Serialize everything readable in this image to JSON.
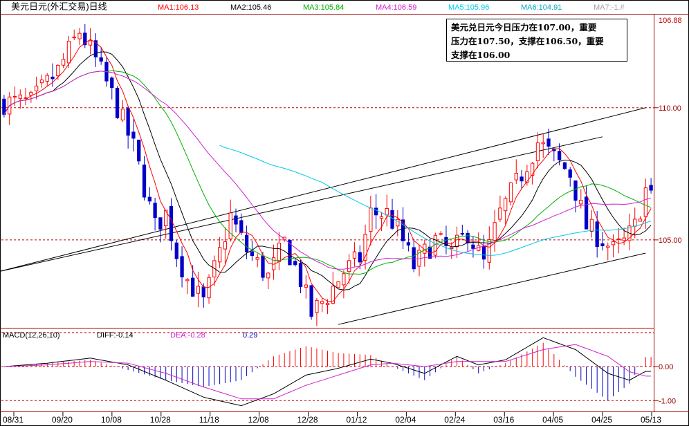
{
  "chart_data": {
    "type": "candlestick",
    "title": "美元日元(外汇交易)日线",
    "indicators": [
      {
        "label": "MA1:106.13",
        "color": "#ff0000"
      },
      {
        "label": "MA2:105.46",
        "color": "#000000"
      },
      {
        "label": "MA3:105.84",
        "color": "#00b000"
      },
      {
        "label": "MA4:106.59",
        "color": "#d020d0"
      },
      {
        "label": "MA5:105.96",
        "color": "#00c8e8"
      },
      {
        "label": "MA6:104.91",
        "color": "#00a8c0"
      },
      {
        "label": "MA7:-1.#",
        "color": "#a0a0a0"
      }
    ],
    "current_price_label": "106.88",
    "current_price": 106.88,
    "y_ticks": [
      110.0,
      105.0
    ],
    "y_tick_labels": [
      "110.00",
      "105.00"
    ],
    "ylim": [
      101.7,
      113.5
    ],
    "x_ticks": [
      "08/31",
      "09/20",
      "10/08",
      "10/28",
      "11/18",
      "12/08",
      "12/28",
      "01/12",
      "02/04",
      "02/24",
      "03/16",
      "04/05",
      "04/25",
      "05/13"
    ],
    "annotation_lines": [
      "美元兑日元今日压力在107.00，重要",
      "压力在107.50，支撑在106.50，重要",
      "支撑在106.00"
    ],
    "price_path": [
      [
        0,
        110.2
      ],
      [
        5,
        110.2
      ],
      [
        10,
        111.4
      ],
      [
        14,
        112.9
      ],
      [
        17,
        111.8
      ],
      [
        20,
        110.5
      ],
      [
        24,
        108.5
      ],
      [
        28,
        105.5
      ],
      [
        30,
        106.0
      ],
      [
        32,
        104.5
      ],
      [
        34,
        103.5
      ],
      [
        37,
        102.6
      ],
      [
        40,
        104.5
      ],
      [
        42,
        105.9
      ],
      [
        45,
        104.6
      ],
      [
        49,
        103.6
      ],
      [
        52,
        104.9
      ],
      [
        55,
        103.5
      ],
      [
        57,
        102.2
      ],
      [
        60,
        102.9
      ],
      [
        63,
        103.8
      ],
      [
        66,
        104.3
      ],
      [
        68,
        106.0
      ],
      [
        71,
        106.0
      ],
      [
        73,
        105.4
      ],
      [
        76,
        104.0
      ],
      [
        80,
        105.0
      ],
      [
        83,
        104.5
      ],
      [
        86,
        105.3
      ],
      [
        89,
        104.1
      ],
      [
        92,
        106.0
      ],
      [
        96,
        107.5
      ],
      [
        99,
        108.7
      ],
      [
        102,
        108.1
      ],
      [
        105,
        107.5
      ],
      [
        108,
        105.5
      ],
      [
        111,
        105.0
      ],
      [
        113,
        104.6
      ],
      [
        115,
        104.9
      ],
      [
        117,
        105.5
      ],
      [
        119,
        106.9
      ]
    ],
    "price_seed": 7,
    "moving_averages": [
      {
        "period": 5,
        "color": "#ff0000"
      },
      {
        "period": 10,
        "color": "#000000"
      },
      {
        "period": 20,
        "color": "#00b000"
      },
      {
        "period": 30,
        "color": "#d020d0"
      },
      {
        "period": 60,
        "color": "#00c8e8",
        "start": 40
      }
    ],
    "channel": {
      "upper": [
        [
          -1,
          103.8
        ],
        [
          119,
          110.0
        ]
      ],
      "middle": [
        [
          -1,
          103.8
        ],
        [
          111,
          108.9
        ]
      ],
      "lower": [
        [
          62,
          101.8
        ],
        [
          119,
          104.5
        ]
      ]
    },
    "macd": {
      "title": "MACD(12,26,10)",
      "diff_label": "DIFF:-0.14",
      "dea_label": "DEA:-0.28",
      "macd_label": "0.29",
      "y_ticks": [
        0.0,
        -1.0
      ],
      "y_tick_labels": [
        "0.00",
        "-1.00"
      ],
      "ylim": [
        -1.3,
        1.1
      ],
      "dotted_levels": [
        1.0,
        0.0,
        -1.0
      ],
      "series": [
        {
          "name": "DIFF",
          "color": "#000000",
          "points": [
            [
              0,
              0.0
            ],
            [
              8,
              0.1
            ],
            [
              16,
              0.25
            ],
            [
              23,
              0.05
            ],
            [
              30,
              -0.4
            ],
            [
              37,
              -0.9
            ],
            [
              44,
              -1.15
            ],
            [
              50,
              -0.8
            ],
            [
              56,
              -0.25
            ],
            [
              62,
              -0.05
            ],
            [
              68,
              0.22
            ],
            [
              72,
              0.1
            ],
            [
              78,
              -0.2
            ],
            [
              84,
              0.3
            ],
            [
              88,
              0.05
            ],
            [
              93,
              0.2
            ],
            [
              100,
              0.85
            ],
            [
              106,
              0.5
            ],
            [
              112,
              -0.2
            ],
            [
              116,
              -0.4
            ],
            [
              119,
              -0.14
            ]
          ]
        },
        {
          "name": "DEA",
          "color": "#d020d0",
          "points": [
            [
              0,
              0.0
            ],
            [
              8,
              0.05
            ],
            [
              16,
              0.15
            ],
            [
              23,
              0.1
            ],
            [
              30,
              -0.2
            ],
            [
              37,
              -0.6
            ],
            [
              44,
              -0.95
            ],
            [
              50,
              -0.95
            ],
            [
              56,
              -0.55
            ],
            [
              62,
              -0.25
            ],
            [
              68,
              0.05
            ],
            [
              72,
              0.1
            ],
            [
              78,
              0.0
            ],
            [
              84,
              0.15
            ],
            [
              88,
              0.15
            ],
            [
              93,
              0.15
            ],
            [
              100,
              0.5
            ],
            [
              106,
              0.65
            ],
            [
              112,
              0.3
            ],
            [
              116,
              -0.15
            ],
            [
              119,
              -0.28
            ]
          ]
        }
      ]
    }
  }
}
